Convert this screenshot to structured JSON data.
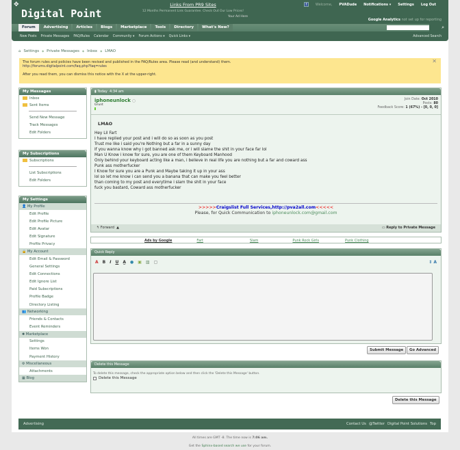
{
  "header": {
    "logo": "Digital Point",
    "promo_link": "Links From PR9 Sites",
    "promo_text": "12 Months Permanent Link Guarantee. Check Out Our Low Prices!",
    "promo_ad": "Your Ad Here",
    "welcome": "Welcome,",
    "username": "PVADude",
    "notifications": "Notifications ▾",
    "settings": "Settings",
    "logout": "Log Out",
    "ga_name": "Google Analytics",
    "ga_text": "not set up for reporting",
    "tabs": [
      "Forum",
      "Advertising",
      "Articles",
      "Blogs",
      "Marketplace",
      "Tools",
      "Directory",
      "What's New?"
    ],
    "subnav": [
      "New Posts",
      "Private Messages",
      "FAQ/Rules",
      "Calendar",
      "Community ▾",
      "Forum Actions ▾",
      "Quick Links ▾"
    ],
    "advanced_search": "Advanced Search"
  },
  "breadcrumb": [
    "Settings",
    "Private Messages",
    "Inbox",
    "LMAO"
  ],
  "notice": {
    "line1": "The forum rules and policies have been revised and published in the FAQ/Rules area. Please read (and understand) them.",
    "link": "http://forums.digitalpoint.com/faq.php?faq=rules",
    "line2": "After you read them, you can dismiss this notice with the X at the upper-right."
  },
  "sidebar": {
    "messages": {
      "title": "My Messages",
      "folders": [
        "Inbox",
        "Sent Items"
      ],
      "links": [
        "Send New Message",
        "Track Messages",
        "Edit Folders"
      ]
    },
    "subs": {
      "title": "My Subscriptions",
      "folders": [
        "Subscriptions"
      ],
      "links": [
        "List Subscriptions",
        "Edit Folders"
      ]
    },
    "settings": {
      "title": "My Settings",
      "groups": [
        {
          "name": "My Profile",
          "icon": "👤",
          "links": [
            "Edit Profile",
            "Edit Profile Picture",
            "Edit Avatar",
            "Edit Signature",
            "Profile Privacy"
          ]
        },
        {
          "name": "My Account",
          "icon": "🔒",
          "links": [
            "Edit Email & Password",
            "General Settings",
            "Edit Connections",
            "Edit Ignore List",
            "Paid Subscriptions",
            "Profile Badge",
            "Directory Listing"
          ]
        },
        {
          "name": "Networking",
          "icon": "👥",
          "links": [
            "Friends & Contacts",
            "Event Reminders"
          ]
        },
        {
          "name": "Marketplace",
          "icon": "✺",
          "links": [
            "Settings",
            "Items Won",
            "Payment History"
          ]
        },
        {
          "name": "Miscellaneous",
          "icon": "⚙",
          "links": [
            "Attachments"
          ]
        },
        {
          "name": "Blog",
          "icon": "▦",
          "links": []
        }
      ]
    }
  },
  "message": {
    "date": "Today",
    "time": "4:34 am",
    "author": "iphoneunlock",
    "rank": "Grunt",
    "join_label": "Join Date:",
    "join": "Oct 2010",
    "posts_label": "Posts:",
    "posts": "80",
    "fb_label": "Feedback Score:",
    "fb": "1 (67%) - [0, 0, 0]",
    "title": "LMAO",
    "lines": [
      "Hey Lil Fart",
      "I have replied your post and i will do so as soon as you post",
      "Trust me like i said you're Nothing but a far in a sunny day",
      "If you wanna know why i got banned ask me, or i will slame the shit in your face far lol",
      "Man U Know i know for sure, you are one of them Keyboard Manhood",
      "Only behind your keyboard acting like a man, i believe in real life you are nothing but a far and coward ass",
      "Punk ass motherfucker",
      "I Know for sure you are a Punk and Maybe taking it up in your ass",
      "lol so let me know i can send you a banana that can make you feel better",
      "than coming to my post and everytime i slam the shit in your face",
      "fuck you bastard, Coward ass motherfucker"
    ],
    "sig_left": ">>>>>",
    "sig_main": "Craigslist Full Services,http://pva2all.com",
    "sig_right": "<<<<<",
    "sig2": "Please, for Quick Communication to",
    "sig_email": "iphoneunlock.com@gmail.com",
    "forward": "Forward",
    "reply": "Reply to Private Message"
  },
  "ads": {
    "label": "Ads by Google",
    "links": [
      "Fart",
      "Slam",
      "Punk Rock Girls",
      "Punk Clothing"
    ]
  },
  "quick_reply": {
    "title": "Quick Reply",
    "submit": "Submit Message",
    "advanced": "Go Advanced"
  },
  "delete": {
    "title": "Delete this Message",
    "text": "To delete this message, check the appropriate option below and then click the 'Delete this Message' button.",
    "checkbox": "Delete this Message",
    "button": "Delete this Message"
  },
  "footer": {
    "left": "Advertising",
    "right": [
      "Contact Us",
      "@Twitter",
      "Digital Point Solutions",
      "Top"
    ],
    "times": "All times are GMT -8. The time now is",
    "time": "7:06 am.",
    "get": "Get the",
    "sphinx": "Sphinx-based search we use",
    "forum": "for your forum."
  }
}
